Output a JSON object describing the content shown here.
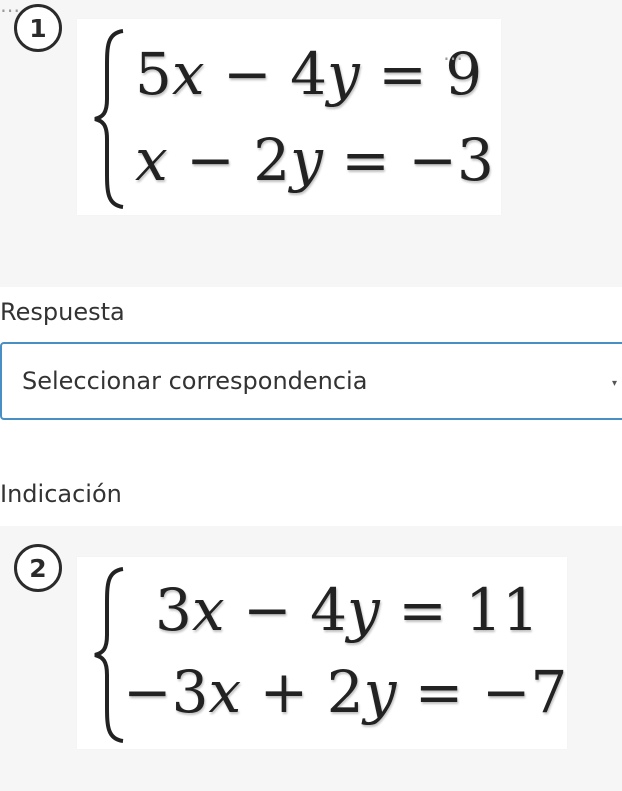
{
  "system_1": {
    "badge": "1",
    "eq1_lhs_a": "5",
    "eq1_var_a": "x",
    "eq1_op": " − 4",
    "eq1_var_b": "y",
    "eq1_rhs": " = 9",
    "eq2_lhs_a": "",
    "eq2_var_a": "x",
    "eq2_op": " − 2",
    "eq2_var_b": "y",
    "eq2_rhs": " = −3",
    "more_icon": "⋯"
  },
  "answer": {
    "label": "Respuesta",
    "select_value": "Seleccionar correspondencia"
  },
  "hint": {
    "label": "Indicación"
  },
  "system_2": {
    "badge": "2",
    "eq1_lhs_a": "3",
    "eq1_var_a": "x",
    "eq1_op": " − 4",
    "eq1_var_b": "y",
    "eq1_rhs": " = 11",
    "eq2_lhs_a": "−3",
    "eq2_var_a": "x",
    "eq2_op": " + 2",
    "eq2_var_b": "y",
    "eq2_rhs": " = −7",
    "more_icon": "⋯"
  },
  "colors": {
    "panel_bg": "#f6f6f6",
    "select_border": "#4a8fc4"
  }
}
